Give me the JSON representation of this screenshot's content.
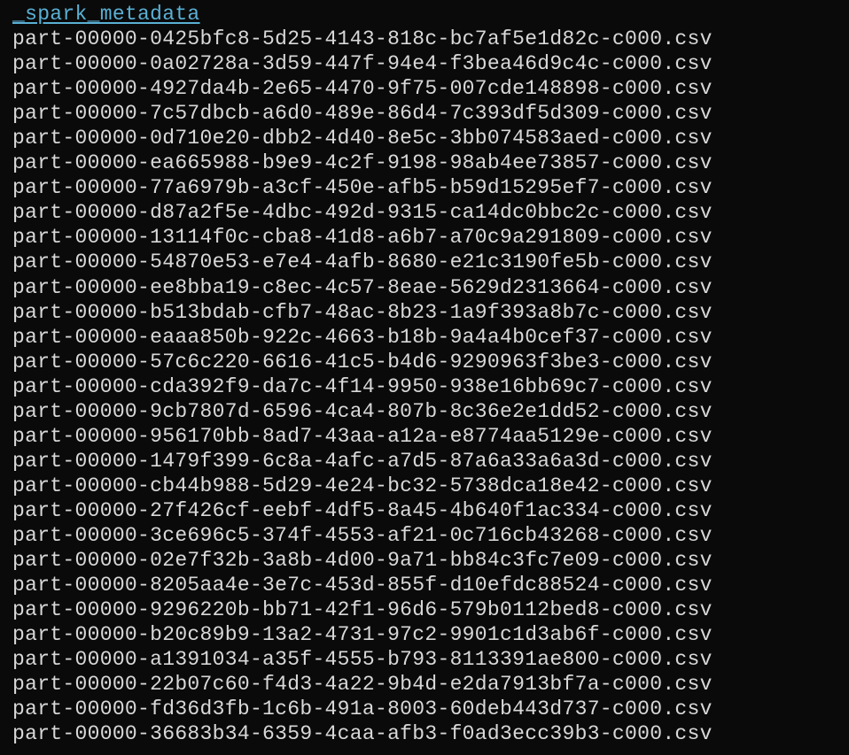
{
  "files": [
    {
      "name": "_spark_metadata",
      "isLink": true
    },
    {
      "name": "part-00000-0425bfc8-5d25-4143-818c-bc7af5e1d82c-c000.csv",
      "isLink": false
    },
    {
      "name": "part-00000-0a02728a-3d59-447f-94e4-f3bea46d9c4c-c000.csv",
      "isLink": false
    },
    {
      "name": "part-00000-4927da4b-2e65-4470-9f75-007cde148898-c000.csv",
      "isLink": false
    },
    {
      "name": "part-00000-7c57dbcb-a6d0-489e-86d4-7c393df5d309-c000.csv",
      "isLink": false
    },
    {
      "name": "part-00000-0d710e20-dbb2-4d40-8e5c-3bb074583aed-c000.csv",
      "isLink": false
    },
    {
      "name": "part-00000-ea665988-b9e9-4c2f-9198-98ab4ee73857-c000.csv",
      "isLink": false
    },
    {
      "name": "part-00000-77a6979b-a3cf-450e-afb5-b59d15295ef7-c000.csv",
      "isLink": false
    },
    {
      "name": "part-00000-d87a2f5e-4dbc-492d-9315-ca14dc0bbc2c-c000.csv",
      "isLink": false
    },
    {
      "name": "part-00000-13114f0c-cba8-41d8-a6b7-a70c9a291809-c000.csv",
      "isLink": false
    },
    {
      "name": "part-00000-54870e53-e7e4-4afb-8680-e21c3190fe5b-c000.csv",
      "isLink": false
    },
    {
      "name": "part-00000-ee8bba19-c8ec-4c57-8eae-5629d2313664-c000.csv",
      "isLink": false
    },
    {
      "name": "part-00000-b513bdab-cfb7-48ac-8b23-1a9f393a8b7c-c000.csv",
      "isLink": false
    },
    {
      "name": "part-00000-eaaa850b-922c-4663-b18b-9a4a4b0cef37-c000.csv",
      "isLink": false
    },
    {
      "name": "part-00000-57c6c220-6616-41c5-b4d6-9290963f3be3-c000.csv",
      "isLink": false
    },
    {
      "name": "part-00000-cda392f9-da7c-4f14-9950-938e16bb69c7-c000.csv",
      "isLink": false
    },
    {
      "name": "part-00000-9cb7807d-6596-4ca4-807b-8c36e2e1dd52-c000.csv",
      "isLink": false
    },
    {
      "name": "part-00000-956170bb-8ad7-43aa-a12a-e8774aa5129e-c000.csv",
      "isLink": false
    },
    {
      "name": "part-00000-1479f399-6c8a-4afc-a7d5-87a6a33a6a3d-c000.csv",
      "isLink": false
    },
    {
      "name": "part-00000-cb44b988-5d29-4e24-bc32-5738dca18e42-c000.csv",
      "isLink": false
    },
    {
      "name": "part-00000-27f426cf-eebf-4df5-8a45-4b640f1ac334-c000.csv",
      "isLink": false
    },
    {
      "name": "part-00000-3ce696c5-374f-4553-af21-0c716cb43268-c000.csv",
      "isLink": false
    },
    {
      "name": "part-00000-02e7f32b-3a8b-4d00-9a71-bb84c3fc7e09-c000.csv",
      "isLink": false
    },
    {
      "name": "part-00000-8205aa4e-3e7c-453d-855f-d10efdc88524-c000.csv",
      "isLink": false
    },
    {
      "name": "part-00000-9296220b-bb71-42f1-96d6-579b0112bed8-c000.csv",
      "isLink": false
    },
    {
      "name": "part-00000-b20c89b9-13a2-4731-97c2-9901c1d3ab6f-c000.csv",
      "isLink": false
    },
    {
      "name": "part-00000-a1391034-a35f-4555-b793-8113391ae800-c000.csv",
      "isLink": false
    },
    {
      "name": "part-00000-22b07c60-f4d3-4a22-9b4d-e2da7913bf7a-c000.csv",
      "isLink": false
    },
    {
      "name": "part-00000-fd36d3fb-1c6b-491a-8003-60deb443d737-c000.csv",
      "isLink": false
    },
    {
      "name": "part-00000-36683b34-6359-4caa-afb3-f0ad3ecc39b3-c000.csv",
      "isLink": false
    }
  ]
}
